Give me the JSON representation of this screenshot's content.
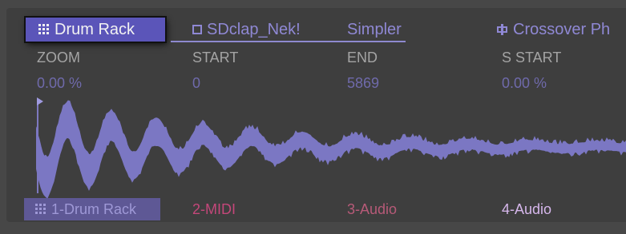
{
  "tabs": [
    {
      "label": "Drum Rack",
      "icon": "grid-icon",
      "active": true
    },
    {
      "label": "SDclap_Nek!",
      "icon": "square-icon"
    },
    {
      "label": "Simpler"
    },
    {
      "label": "Crossover Ph",
      "icon": "crossover-icon"
    }
  ],
  "params": {
    "zoom": {
      "label": "ZOOM",
      "value": "0.00 %"
    },
    "start": {
      "label": "START",
      "value": "0"
    },
    "end": {
      "label": "END",
      "value": "5869"
    },
    "s_start": {
      "label": "S START",
      "value": "0.00 %"
    }
  },
  "tracks": [
    {
      "label": "1-Drum Rack",
      "icon": "grid-icon",
      "color": "#9e98d6"
    },
    {
      "label": "2-MIDI",
      "color": "#c4477a"
    },
    {
      "label": "3-Audio",
      "color": "#b75a78"
    },
    {
      "label": "4-Audio",
      "color": "#d6b7ec"
    }
  ],
  "colors": {
    "accent": "#5b55b9",
    "waveform": "#7b77c3",
    "panel": "#3e3e3e"
  }
}
